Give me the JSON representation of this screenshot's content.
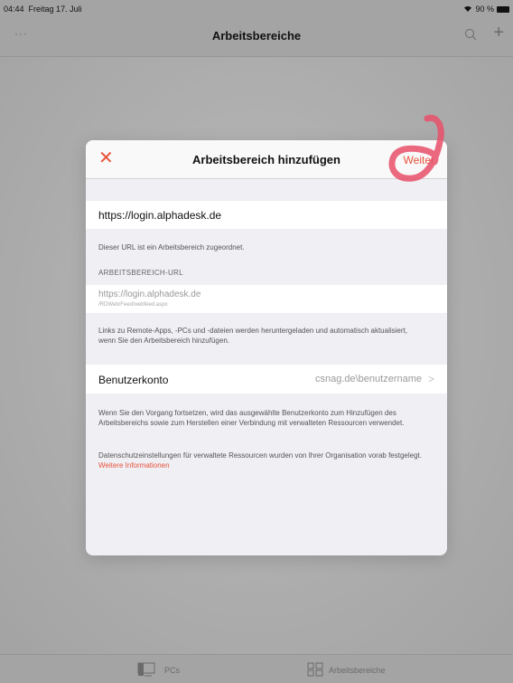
{
  "status_bar": {
    "time": "04:44",
    "date": "Freitag 17. Juli",
    "battery": "90 %"
  },
  "nav": {
    "more": "···",
    "title": "Arbeitsbereiche"
  },
  "modal": {
    "close": "✕",
    "title": "Arbeitsbereich hinzufügen",
    "next": "Weiter",
    "url": "https://login.alphadesk.de",
    "url_note": "Dieser URL ist ein Arbeitsbereich zugeordnet.",
    "section_header": "ARBEITSBEREICH-URL",
    "workspace_url": "https://login.alphadesk.de",
    "workspace_url_path": "/RDWeb/Feed/webfeed.aspx",
    "download_note": "Links zu Remote-Apps, -PCs und -dateien werden heruntergeladen und automatisch aktualisiert, wenn Sie den Arbeitsbereich hinzufügen.",
    "account_label": "Benutzerkonto",
    "account_value": "csnag.de\\benutzername",
    "continue_note": "Wenn Sie den Vorgang fortsetzen, wird das ausgewählte Benutzerkonto zum Hinzufügen des Arbeitsbereichs sowie zum Herstellen einer Verbindung mit verwalteten Ressourcen verwendet.",
    "privacy_note": "Datenschutzeinstellungen für verwaltete Ressourcen wurden von Ihrer Organisation vorab festgelegt.",
    "more_info": "Weitere Informationen"
  },
  "tabs": [
    {
      "label": "PCs"
    },
    {
      "label": "Arbeitsbereiche"
    }
  ],
  "colors": {
    "accent": "#e8533b",
    "annotation": "#e8506a"
  }
}
